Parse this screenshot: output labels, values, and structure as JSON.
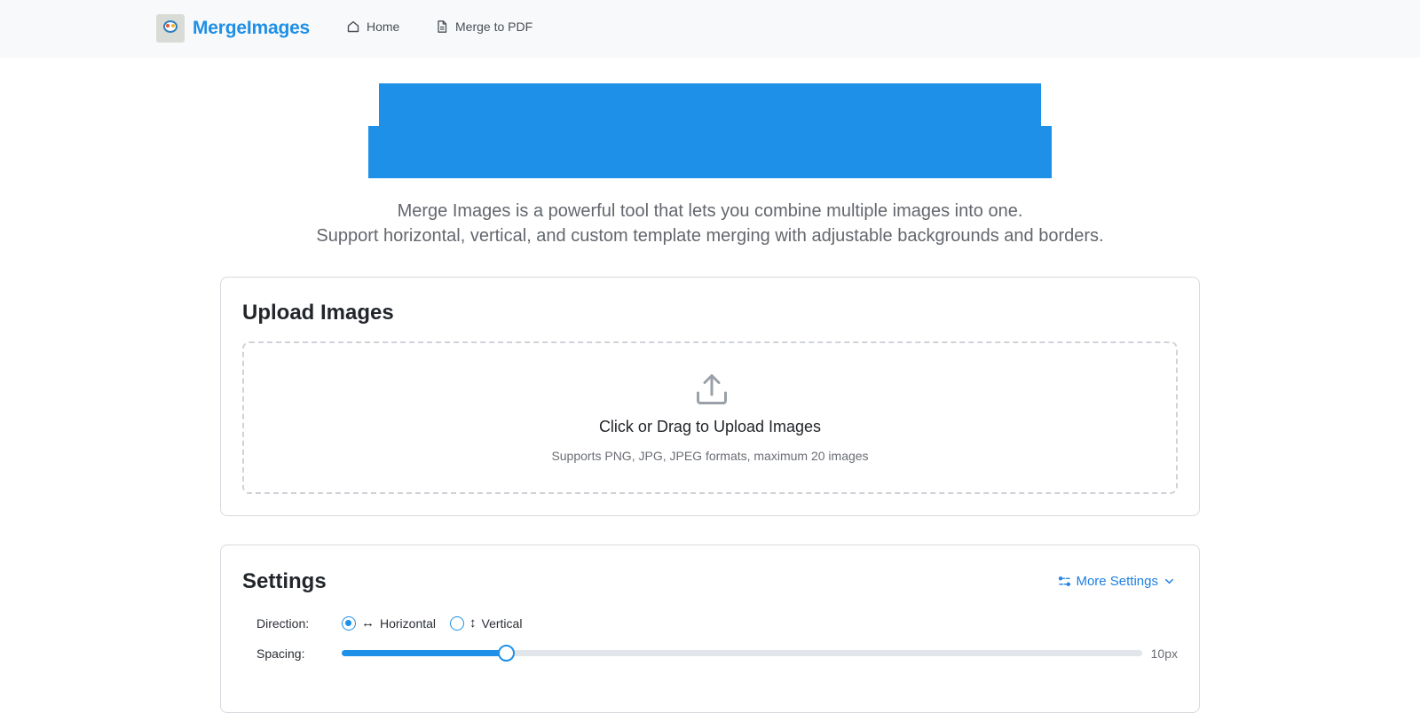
{
  "header": {
    "brand": "MergeImages",
    "nav": [
      {
        "label": "Home",
        "icon": "home-icon"
      },
      {
        "label": "Merge to PDF",
        "icon": "document-icon"
      }
    ]
  },
  "intro": {
    "line1": "Merge Images is a powerful tool that lets you combine multiple images into one.",
    "line2": "Support horizontal, vertical, and custom template merging with adjustable backgrounds and borders."
  },
  "upload": {
    "title": "Upload Images",
    "drop_title": "Click or Drag to Upload Images",
    "drop_subtitle": "Supports PNG, JPG, JPEG formats, maximum 20 images",
    "icon": "upload-icon"
  },
  "settings": {
    "title": "Settings",
    "more_settings": "More Settings",
    "direction_label": "Direction:",
    "direction_options": [
      {
        "label": "Horizontal",
        "glyph": "↔",
        "checked": true
      },
      {
        "label": "Vertical",
        "glyph": "↕",
        "checked": false
      }
    ],
    "spacing_label": "Spacing:",
    "spacing_value": "10px",
    "spacing_fraction": 0.205
  },
  "colors": {
    "accent": "#1e90e8",
    "brand_text": "#1e8fe6",
    "link": "#1e7fe0"
  }
}
